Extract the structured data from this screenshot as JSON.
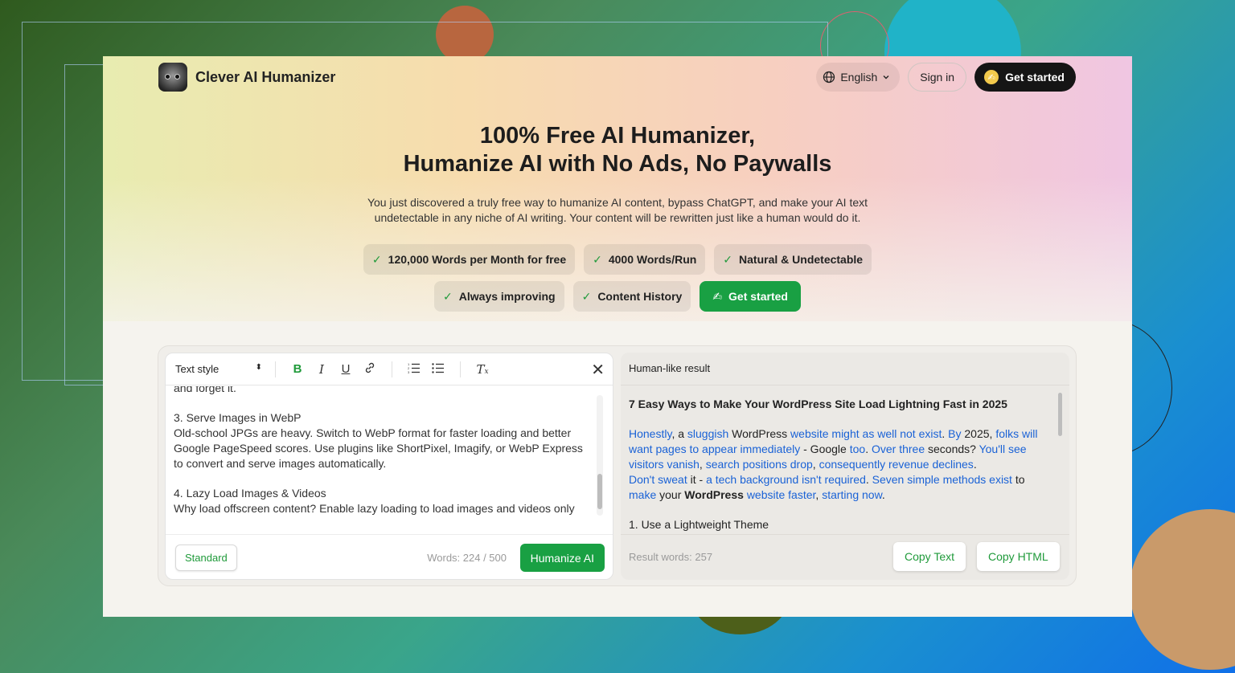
{
  "brand": {
    "name": "Clever AI Humanizer",
    "logo_icon": "face-logo-icon"
  },
  "nav": {
    "language": "English",
    "language_icon": "globe-icon",
    "signin": "Sign in",
    "get_started": "Get started",
    "get_started_icon": "writing-hand-icon"
  },
  "hero": {
    "title_line1": "100% Free AI Humanizer,",
    "title_line2": "Humanize AI with No Ads, No Paywalls",
    "subtitle_line1": "You just discovered a truly free way to humanize AI content, bypass ChatGPT, and make your AI text",
    "subtitle_line2": "undetectable in any niche of AI writing. Your content will be rewritten just like a human would do it."
  },
  "features": {
    "row1": [
      "120,000 Words per Month for free",
      "4000 Words/Run",
      "Natural & Undetectable"
    ],
    "row2": [
      "Always improving",
      "Content History"
    ],
    "cta": "Get started",
    "cta_icon": "✍"
  },
  "editor": {
    "text_style": "Text style",
    "toolbar_icons": [
      "bold-icon",
      "italic-icon",
      "underline-icon",
      "link-icon",
      "ordered-list-icon",
      "bullet-list-icon",
      "clear-format-icon"
    ],
    "content": {
      "line0": "and forget it.",
      "h3": "3. Serve Images in WebP",
      "p3_1": "Old-school JPGs are heavy. Switch to WebP format for faster loading and better",
      "p3_2": "Google PageSpeed scores. Use plugins like ShortPixel, Imagify, or WebP Express",
      "p3_3": "to convert and serve images automatically.",
      "h4": "4. Lazy Load Images & Videos",
      "p4_1": "Why load offscreen content? Enable lazy loading to load images and videos only"
    },
    "mode": "Standard",
    "word_count": "Words: 224 / 500",
    "humanize": "Humanize AI"
  },
  "result": {
    "header": "Human-like result",
    "title": "7 Easy Ways to Make Your WordPress Site Load Lightning Fast in 2025",
    "words": "Result words: 257",
    "copy_text": "Copy Text",
    "copy_html": "Copy HTML",
    "list_item": "1. Use a Lightweight Theme",
    "highlight_color": "#1a62d6"
  },
  "colors": {
    "accent_green": "#19a043",
    "dark": "#151515"
  }
}
